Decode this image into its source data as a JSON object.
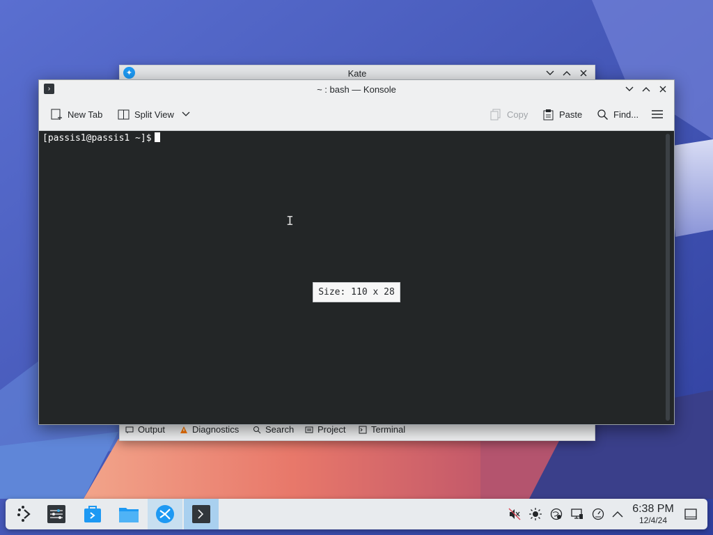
{
  "kate": {
    "title": "Kate",
    "bottom_tabs": [
      {
        "label": "Output",
        "icon": "output-icon"
      },
      {
        "label": "Diagnostics",
        "icon": "warning-icon"
      },
      {
        "label": "Search",
        "icon": "search-icon"
      },
      {
        "label": "Project",
        "icon": "project-icon"
      },
      {
        "label": "Terminal",
        "icon": "terminal-icon"
      }
    ]
  },
  "konsole": {
    "title": "~ : bash — Konsole",
    "toolbar": {
      "new_tab": "New Tab",
      "split_view": "Split View",
      "copy": "Copy",
      "paste": "Paste",
      "find": "Find..."
    },
    "prompt": "[passis1@passis1 ~]$",
    "size_tooltip": "Size: 110 x 28"
  },
  "taskbar": {
    "time": "6:38 PM",
    "date": "12/4/24",
    "apps": [
      "app-launcher-icon",
      "system-settings-icon",
      "discover-icon",
      "dolphin-icon",
      "kate-icon",
      "konsole-icon"
    ],
    "tray": [
      "volume-muted-icon",
      "brightness-icon",
      "network-icon",
      "display-icon",
      "updates-icon",
      "tray-expand-icon",
      "show-desktop-icon"
    ]
  },
  "colors": {
    "terminal_bg": "#232627",
    "accent": "#3daee9",
    "window_bg": "#eff0f1"
  }
}
